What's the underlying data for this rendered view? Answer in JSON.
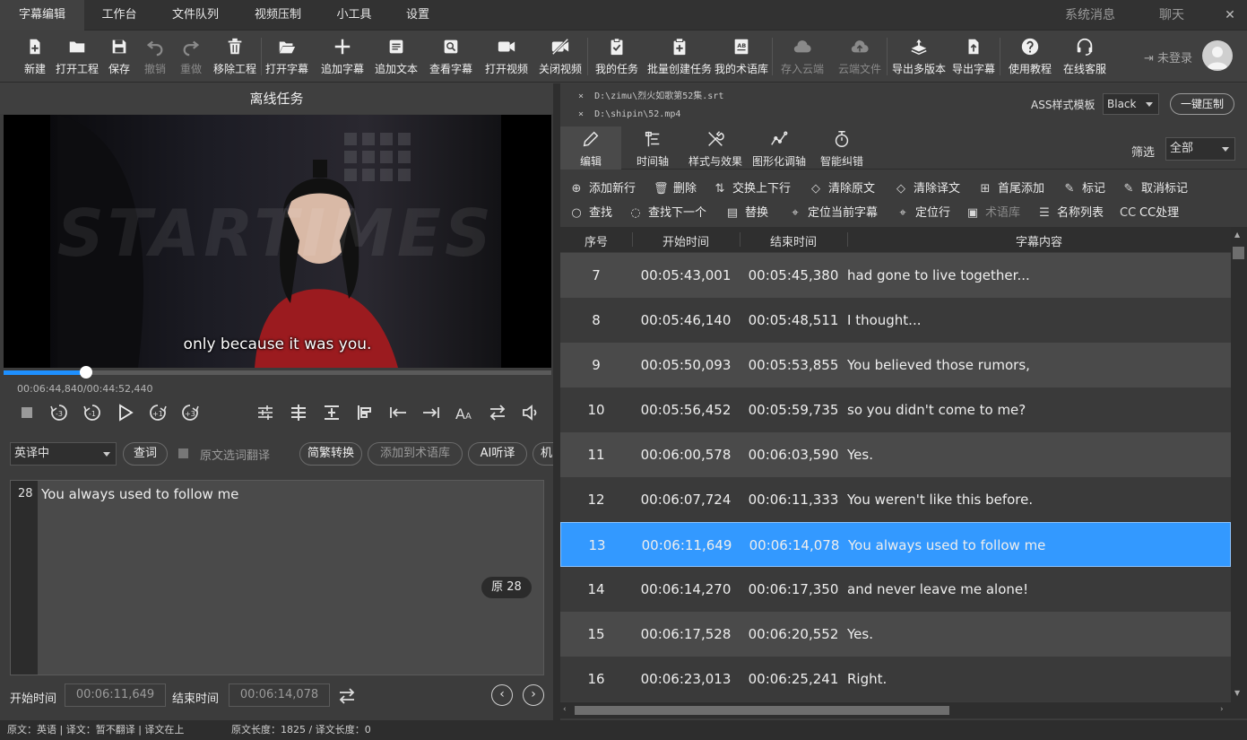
{
  "menu": {
    "tabs": [
      "字幕编辑",
      "工作台",
      "文件队列",
      "视频压制",
      "小工具",
      "设置"
    ],
    "active": "字幕编辑",
    "right_items": [
      "系统消息",
      "聊天"
    ],
    "window_buttons": [
      "—",
      "⬜",
      "✕"
    ]
  },
  "toolbar": {
    "items": [
      {
        "label": "新建",
        "icon": "new-file-icon"
      },
      {
        "label": "打开工程",
        "icon": "folder-icon"
      },
      {
        "label": "保存",
        "icon": "save-icon"
      },
      {
        "label": "撤销",
        "icon": "undo-icon",
        "disabled": true
      },
      {
        "label": "重做",
        "icon": "redo-icon",
        "disabled": true
      },
      {
        "label": "移除工程",
        "icon": "trash-icon"
      },
      {
        "label": "打开字幕",
        "icon": "open-folder-icon"
      },
      {
        "label": "追加字幕",
        "icon": "plus-icon"
      },
      {
        "label": "追加文本",
        "icon": "text-doc-icon"
      },
      {
        "label": "查看字幕",
        "icon": "view-subtitle-icon"
      },
      {
        "label": "打开视频",
        "icon": "camera-icon"
      },
      {
        "label": "关闭视频",
        "icon": "camera-off-icon"
      },
      {
        "label": "我的任务",
        "icon": "clipboard-check-icon"
      },
      {
        "label": "批量创建任务",
        "icon": "batch-task-icon"
      },
      {
        "label": "我的术语库",
        "icon": "glossary-icon"
      },
      {
        "label": "存入云端",
        "icon": "cloud-icon",
        "disabled": true
      },
      {
        "label": "云端文件",
        "icon": "cloud-upload-icon",
        "disabled": true
      },
      {
        "label": "导出多版本",
        "icon": "layers-export-icon"
      },
      {
        "label": "导出字幕",
        "icon": "file-export-icon"
      },
      {
        "label": "使用教程",
        "icon": "help-icon"
      },
      {
        "label": "在线客服",
        "icon": "headset-icon"
      }
    ],
    "login_text": "未登录"
  },
  "left": {
    "title": "离线任务",
    "video_subtitle": "only because it was you.",
    "watermark": "STARTIMES",
    "time_readout": "00:06:44,840/00:44:52,440",
    "progress_fraction": 0.15,
    "lang_select": "英译中",
    "lookup_button": "查词",
    "select_translate_label": "原文选词翻译",
    "pills": [
      "简繁转换",
      "添加到术语库",
      "AI听译",
      "机"
    ],
    "editor_line_no": "28",
    "editor_text": "You always used to follow me",
    "badge": "原 28",
    "start_label": "开始时间",
    "start_value": "00:06:11,649",
    "end_label": "结束时间",
    "end_value": "00:06:14,078"
  },
  "right": {
    "files": [
      "D:\\zimu\\烈火如歌第52集.srt",
      "D:\\shipin\\52.mp4"
    ],
    "ass_label": "ASS样式模板",
    "ass_value": "Black",
    "oneclick_button": "一键压制",
    "tabs": [
      {
        "label": "编辑",
        "icon": "pencil-icon"
      },
      {
        "label": "时间轴",
        "icon": "timeline-icon"
      },
      {
        "label": "样式与效果",
        "icon": "tools-icon"
      },
      {
        "label": "图形化调轴",
        "icon": "graph-icon"
      },
      {
        "label": "智能纠错",
        "icon": "stopwatch-icon"
      }
    ],
    "filter_label": "筛选",
    "filter_value": "全部",
    "actions_row1": [
      {
        "label": "添加新行",
        "icon": "⊕"
      },
      {
        "label": "删除",
        "icon": "🗑"
      },
      {
        "label": "交换上下行",
        "icon": "⇅"
      },
      {
        "label": "清除原文",
        "icon": "◇"
      },
      {
        "label": "清除译文",
        "icon": "◇"
      },
      {
        "label": "首尾添加",
        "icon": "⊞"
      },
      {
        "label": "标记",
        "icon": "✎"
      },
      {
        "label": "取消标记",
        "icon": "✎"
      }
    ],
    "actions_row2": [
      {
        "label": "查找",
        "icon": "○"
      },
      {
        "label": "查找下一个",
        "icon": "◌"
      },
      {
        "label": "替换",
        "icon": "▤"
      },
      {
        "label": "定位当前字幕",
        "icon": "⌖"
      },
      {
        "label": "定位行",
        "icon": "⌖"
      },
      {
        "label": "术语库",
        "icon": "▣",
        "disabled": true
      },
      {
        "label": "名称列表",
        "icon": "☰"
      },
      {
        "label": "CC处理",
        "icon": "CC"
      }
    ],
    "columns": [
      "序号",
      "开始时间",
      "结束时间",
      "字幕内容"
    ],
    "rows": [
      {
        "no": "7",
        "start": "00:05:43,001",
        "end": "00:05:45,380",
        "text": "had gone to live together..."
      },
      {
        "no": "8",
        "start": "00:05:46,140",
        "end": "00:05:48,511",
        "text": "I thought..."
      },
      {
        "no": "9",
        "start": "00:05:50,093",
        "end": "00:05:53,855",
        "text": "You believed those rumors,"
      },
      {
        "no": "10",
        "start": "00:05:56,452",
        "end": "00:05:59,735",
        "text": "so you didn't come to me?"
      },
      {
        "no": "11",
        "start": "00:06:00,578",
        "end": "00:06:03,590",
        "text": "Yes."
      },
      {
        "no": "12",
        "start": "00:06:07,724",
        "end": "00:06:11,333",
        "text": "You weren't like this before."
      },
      {
        "no": "13",
        "start": "00:06:11,649",
        "end": "00:06:14,078",
        "text": "You always used to follow me",
        "selected": true
      },
      {
        "no": "14",
        "start": "00:06:14,270",
        "end": "00:06:17,350",
        "text": "and never leave me alone!"
      },
      {
        "no": "15",
        "start": "00:06:17,528",
        "end": "00:06:20,552",
        "text": "Yes."
      },
      {
        "no": "16",
        "start": "00:06:23,013",
        "end": "00:06:25,241",
        "text": "Right."
      }
    ],
    "selected_color": "#3399ff"
  },
  "status": {
    "left": "原文：英语 | 译文：暂不翻译 | 译文在上",
    "right": "原文长度：1825 / 译文长度：0"
  }
}
